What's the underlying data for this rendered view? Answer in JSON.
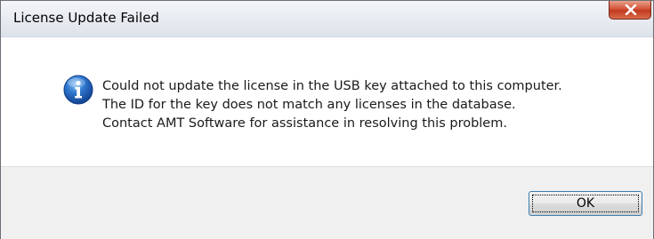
{
  "dialog": {
    "title": "License Update Failed",
    "icon": "info-icon",
    "close_icon": "close-icon",
    "message_lines": [
      "Could not update the license in the USB key attached to this computer.",
      "The ID for the key does not match any licenses in the database.",
      "Contact AMT Software for assistance in resolving this problem."
    ],
    "ok_label": "OK"
  },
  "colors": {
    "close_button": "#c9462a",
    "icon_blue": "#1f5fb8",
    "footer_bg": "#f0f0f0",
    "button_focus_border": "#3c7fb1"
  }
}
